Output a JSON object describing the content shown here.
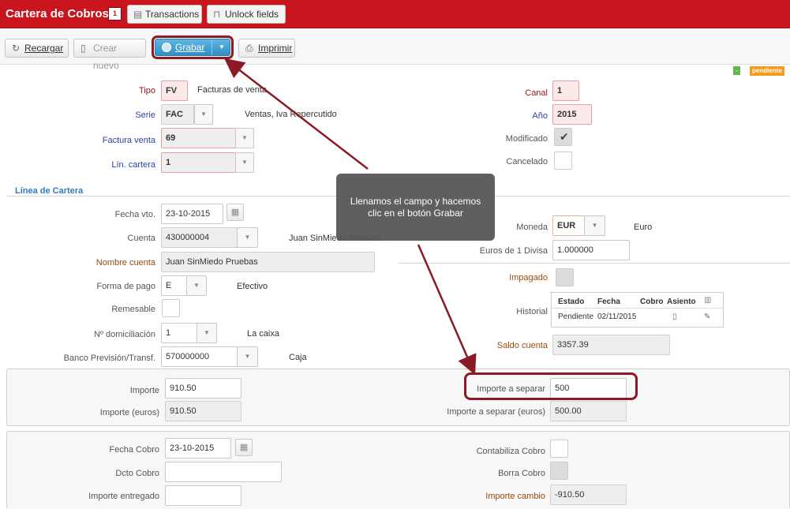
{
  "titlebar": {
    "title": "Cartera de Cobros",
    "badge": "1",
    "transactions_label": "Transactions",
    "unlock_label": "Unlock fields"
  },
  "toolbar": {
    "recargar_label": "Recargar",
    "crear_label": "Crear nuevo",
    "grabar_label": "Grabar",
    "imprimir_label": "Imprimir"
  },
  "status": {
    "green_mark": "-",
    "badge": "pendiente"
  },
  "header_left": {
    "tipo_label": "Tipo",
    "tipo_value": "FV",
    "tipo_desc": "Facturas de venta",
    "serie_label": "Serie",
    "serie_value": "FAC",
    "serie_desc": "Ventas, Iva Repercutido",
    "factura_label": "Factura venta",
    "factura_value": "69",
    "lin_label": "Lín. cartera",
    "lin_value": "1"
  },
  "header_right": {
    "canal_label": "Canal",
    "canal_value": "1",
    "anio_label": "Año",
    "anio_value": "2015",
    "modificado_label": "Modificado",
    "cancelado_label": "Cancelado"
  },
  "linea": {
    "section_title": "Línea de Cartera",
    "fecha_vto_label": "Fecha vto.",
    "fecha_vto_value": "23-10-2015",
    "cuenta_label": "Cuenta",
    "cuenta_value": "430000004",
    "cuenta_desc": "Juan SinMiedo Pruebas",
    "nombre_label": "Nombre cuenta",
    "nombre_value": "Juan SinMiedo Pruebas",
    "forma_label": "Forma de pago",
    "forma_value": "E",
    "forma_desc": "Efectivo",
    "remesable_label": "Remesable",
    "domic_label": "Nº domiciliación",
    "domic_value": "1",
    "domic_desc": "La caixa",
    "banco_label": "Banco Previsión/Transf.",
    "banco_value": "570000000",
    "banco_desc": "Caja",
    "moneda_label": "Moneda",
    "moneda_value": "EUR",
    "moneda_desc": "Euro",
    "euros_label": "Euros de 1 Divisa",
    "euros_value": "1.000000",
    "impagado_label": "Impagado",
    "historial_label": "Historial",
    "saldo_label": "Saldo cuenta",
    "saldo_value": "3357.39"
  },
  "historial": {
    "headers": [
      "Estado",
      "Fecha",
      "Cobro",
      "Asiento"
    ],
    "row": {
      "estado": "Pendiente",
      "fecha": "02/11/2015"
    }
  },
  "importes": {
    "importe_label": "Importe",
    "importe_value": "910.50",
    "importe_eur_label": "Importe (euros)",
    "importe_eur_value": "910.50",
    "separar_label": "Importe a separar",
    "separar_value": "500",
    "separar_eur_label": "Importe a separar (euros)",
    "separar_eur_value": "500.00"
  },
  "cobro": {
    "fecha_label": "Fecha Cobro",
    "fecha_value": "23-10-2015",
    "dcto_label": "Dcto Cobro",
    "dcto_value": "",
    "entregado_label": "Importe entregado",
    "entregado_value": "",
    "contabiliza_label": "Contabiliza Cobro",
    "borra_label": "Borra Cobro",
    "cambio_label": "Importe cambio",
    "cambio_value": "-910.50"
  },
  "tooltip": {
    "text_line1": "Llenamos el campo y hacemos",
    "text_line2": "clic en el botón Grabar"
  },
  "colors": {
    "brand_red": "#c9151d",
    "accent_blue": "#2f8fc4",
    "callout": "#8b1a24",
    "status_orange": "#f29b1d"
  }
}
